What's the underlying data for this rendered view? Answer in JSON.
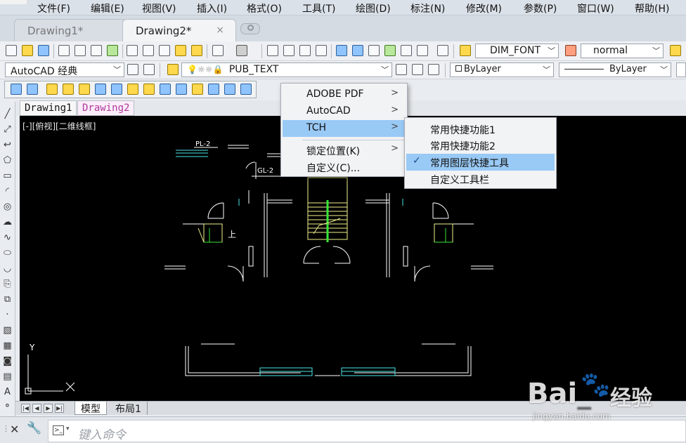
{
  "menubar": {
    "items": [
      "文件(F)",
      "编辑(E)",
      "视图(V)",
      "插入(I)",
      "格式(O)",
      "工具(T)",
      "绘图(D)",
      "标注(N)",
      "修改(M)",
      "参数(P)",
      "窗口(W)",
      "帮助(H)"
    ]
  },
  "doc_tabs": {
    "tab1": "Drawing1*",
    "tab2": "Drawing2*",
    "close_glyph": "×"
  },
  "toolbar_row1": {
    "textstyle_value": "DIM_FONT",
    "dimstyle_value": "normal"
  },
  "toolbar_row2": {
    "workspace_value": "AutoCAD 经典",
    "layer_value": "PUB_TEXT",
    "color_value": "ByLayer",
    "linetype_value": "ByLayer"
  },
  "drawing_tabs": {
    "tab1": "Drawing1",
    "tab2": "Drawing2"
  },
  "canvas": {
    "view_label": "[-][俯视][二维线框]",
    "annotations": {
      "pl": "PL-2",
      "gl": "GL-2",
      "stair_char": "上",
      "ucs_y": "Y"
    },
    "colors": {
      "background": "#000000",
      "line_white": "#ffffff",
      "line_cyan": "#4ce6e6",
      "line_yellow": "#f2f28c",
      "line_green": "#39e639"
    }
  },
  "layout_tabs": {
    "model": "模型",
    "layout1": "布局1"
  },
  "command_line": {
    "placeholder": "键入命令",
    "close_glyph": "✕"
  },
  "context_menu": {
    "items": [
      "ADOBE PDF",
      "AutoCAD",
      "TCH",
      "锁定位置(K)",
      "自定义(C)..."
    ],
    "highlighted": "TCH",
    "submenu_arrow": ">"
  },
  "submenu": {
    "items": [
      "常用快捷功能1",
      "常用快捷功能2",
      "常用图层快捷工具",
      "自定义工具栏"
    ],
    "checked_item": "常用图层快捷工具",
    "check_glyph": "✓"
  },
  "watermark": {
    "brand_latin": "Bai",
    "brand_latin2": "du",
    "brand_cn": "经验",
    "url": "jingyan.baidu.com"
  }
}
